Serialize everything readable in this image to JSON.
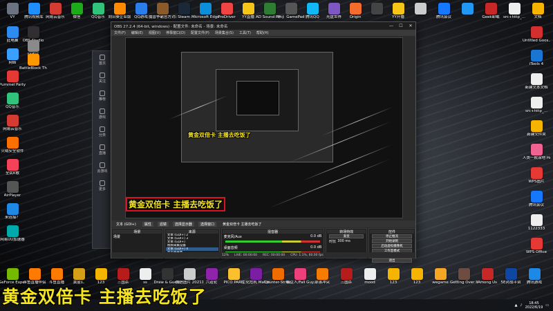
{
  "desktop_top": [
    {
      "label": "VY",
      "color": "#6b7280"
    },
    {
      "label": "腾讯视频库",
      "color": "#1f8fff"
    },
    {
      "label": "网易云音乐",
      "color": "#d43c33"
    },
    {
      "label": "微信",
      "color": "#1aad19"
    },
    {
      "label": "QQ音乐",
      "color": "#31c27c"
    },
    {
      "label": "向日葵企业版",
      "color": "#ff8a00"
    },
    {
      "label": "QQ游戏",
      "color": "#2b7de9"
    },
    {
      "label": "魔兽争霸官方对战平台",
      "color": "#8b5a2b"
    },
    {
      "label": "Steam",
      "color": "#1b2838"
    },
    {
      "label": "Microsoft Edge",
      "color": "#0b8fd8"
    },
    {
      "label": "ProDriver",
      "color": "#e44"
    },
    {
      "label": "YY直播",
      "color": "#f5c518"
    },
    {
      "label": "AD Sound Recorder",
      "color": "#2e7d32"
    },
    {
      "label": "补丁 GamePad",
      "color": "#555"
    },
    {
      "label": "腾讯QQ",
      "color": "#12b7f5"
    },
    {
      "label": "光盘世界",
      "color": "#7e57c2"
    },
    {
      "label": "Origin",
      "color": "#f56c2d"
    },
    {
      "label": "",
      "color": "#444"
    },
    {
      "label": "YY开播",
      "color": "#f5c518"
    },
    {
      "label": "",
      "color": "#ccc"
    },
    {
      "label": "腾讯会议",
      "color": "#1677ff"
    },
    {
      "label": "",
      "color": "#2196f3"
    },
    {
      "label": "Geek卸载",
      "color": "#c62828"
    },
    {
      "label": "src+http_...",
      "color": "#eee"
    },
    {
      "label": "文档",
      "color": "#f4b400"
    }
  ],
  "desktop_left": [
    {
      "label": "此电脑",
      "color": "#2d8cf0"
    },
    {
      "label": "网络",
      "color": "#3aa0ff"
    },
    {
      "label": "Pummel Party",
      "color": "#e53935"
    },
    {
      "label": "QQ音乐",
      "color": "#31c27c"
    },
    {
      "label": "网易云音乐",
      "color": "#d43c33"
    },
    {
      "label": "火绒安全软件",
      "color": "#ff6f00"
    },
    {
      "label": "全民K歌",
      "color": "#f5425b"
    },
    {
      "label": "AirPlayer",
      "color": "#555"
    },
    {
      "label": "来连接？",
      "color": "#1e88e5"
    },
    {
      "label": "网易UU加速器",
      "color": "#0aa"
    }
  ],
  "desktop_left2": [
    {
      "label": "OBS Studio",
      "color": "#302e31"
    },
    {
      "label": "回收站",
      "color": "#8a8a8a"
    },
    {
      "label": "BattleBlock Theater",
      "color": "#ff9800"
    }
  ],
  "desktop_right": [
    {
      "label": "Untitled Goos...",
      "color": "#d32f2f"
    },
    {
      "label": "iTools 4",
      "color": "#1976d2"
    },
    {
      "label": "新建文本文档",
      "color": "#eee"
    },
    {
      "label": "src+http_...",
      "color": "#eee"
    },
    {
      "label": "新建文件夹",
      "color": "#f4b400"
    },
    {
      "label": "人类一败涂地 Human Fa...",
      "color": "#f06292"
    },
    {
      "label": "WPS图片",
      "color": "#e53935"
    },
    {
      "label": "腾讯会议",
      "color": "#1677ff"
    },
    {
      "label": "1122333",
      "color": "#eee"
    },
    {
      "label": "WPS Office",
      "color": "#e53935"
    }
  ],
  "desktop_bottom": [
    {
      "label": "GeForce Experience",
      "color": "#76b900"
    },
    {
      "label": "斗鱼直播伴侣",
      "color": "#ff7a00"
    },
    {
      "label": "斗鱼直播",
      "color": "#ff7a00"
    },
    {
      "label": "黄金汇",
      "color": "#d4a017"
    },
    {
      "label": "123",
      "color": "#f4b400"
    },
    {
      "label": "三国杀",
      "color": "#b71c1c"
    },
    {
      "label": "ss",
      "color": "#eee"
    },
    {
      "label": "Draw & Guess",
      "color": "#333"
    },
    {
      "label": "微信图片 2021120...",
      "color": "#ccc"
    },
    {
      "label": "六道轮",
      "color": "#8e24aa"
    },
    {
      "label": "PICO PARK",
      "color": "#fbc02d"
    },
    {
      "label": "生化危机 Mahjong...",
      "color": "#7b1fa2"
    },
    {
      "label": "Counter-Strike: Global Off...",
      "color": "#ef6c00"
    },
    {
      "label": "糖豆人/Fall Guys",
      "color": "#ec407a"
    },
    {
      "label": "部落冲突",
      "color": "#f57c00"
    },
    {
      "label": "三国杀",
      "color": "#b71c1c"
    },
    {
      "label": "mood",
      "color": "#eee"
    },
    {
      "label": "123",
      "color": "#f4b400"
    },
    {
      "label": "123",
      "color": "#f4b400"
    },
    {
      "label": "wegame",
      "color": "#f5a623"
    },
    {
      "label": "Getting Over It wi...",
      "color": "#6d4c41"
    },
    {
      "label": "Among Us",
      "color": "#c62828"
    },
    {
      "label": "5E对战平台",
      "color": "#0d47a1"
    },
    {
      "label": "腾讯游戏",
      "color": "#1e88e5"
    }
  ],
  "obs": {
    "title": "OBS 27.2.4 (64-bit, windows) - 配置文件: 未命名 - 场景: 未命名",
    "menu": [
      "文件(F)",
      "编辑(E)",
      "视图(V)",
      "停靠窗口(D)",
      "配置文件(P)",
      "场景集合(S)",
      "工具(T)",
      "帮助(H)"
    ],
    "preview_caption": "黄金双倍卡 主播去吃饭了",
    "source_bar": [
      "文本 (GDI+)",
      "属性",
      "滤镜",
      "选择显示器",
      "选择窗口",
      "黄金双倍卡 主播去吃饭了"
    ],
    "scenes_header": "场景",
    "scene_item": "场景",
    "sources_header": "来源",
    "sources": [
      "文本 (GDI+) 2",
      "文本 (GDI+) 3",
      "文本 (GDI+)",
      "视频采集设备",
      "文本 (GDI+) 4",
      "显示器采集",
      "窗口采集"
    ],
    "mixer_header": "混音器",
    "mixer": [
      {
        "name": "麦克风/Aux",
        "level": "0.0 dB"
      },
      {
        "name": "桌面音频",
        "level": "0.0 dB"
      }
    ],
    "transitions_header": "转场特效",
    "transition_type": "渐变",
    "transition_duration_label": "时长",
    "transition_duration": "300 ms",
    "controls_header": "控件",
    "controls": [
      "停止推流",
      "开始录制",
      "启动虚拟摄像机",
      "工作室模式",
      "设置",
      "退出"
    ],
    "status": {
      "live": "LIVE: 00:00:00",
      "rec": "REC: 00:00:00",
      "cpu": "CPU: 1.1%, 60.00 fps",
      "dropped": "12%"
    }
  },
  "behind_app": {
    "items": [
      "首页",
      "关注",
      "推荐",
      "游戏",
      "分类",
      "直播",
      "云游戏",
      "更多"
    ]
  },
  "taskbar": {
    "time": "18:45",
    "date": "2022/6/19"
  },
  "overlay_caption": "黄金双倍卡 主播去吃饭了"
}
